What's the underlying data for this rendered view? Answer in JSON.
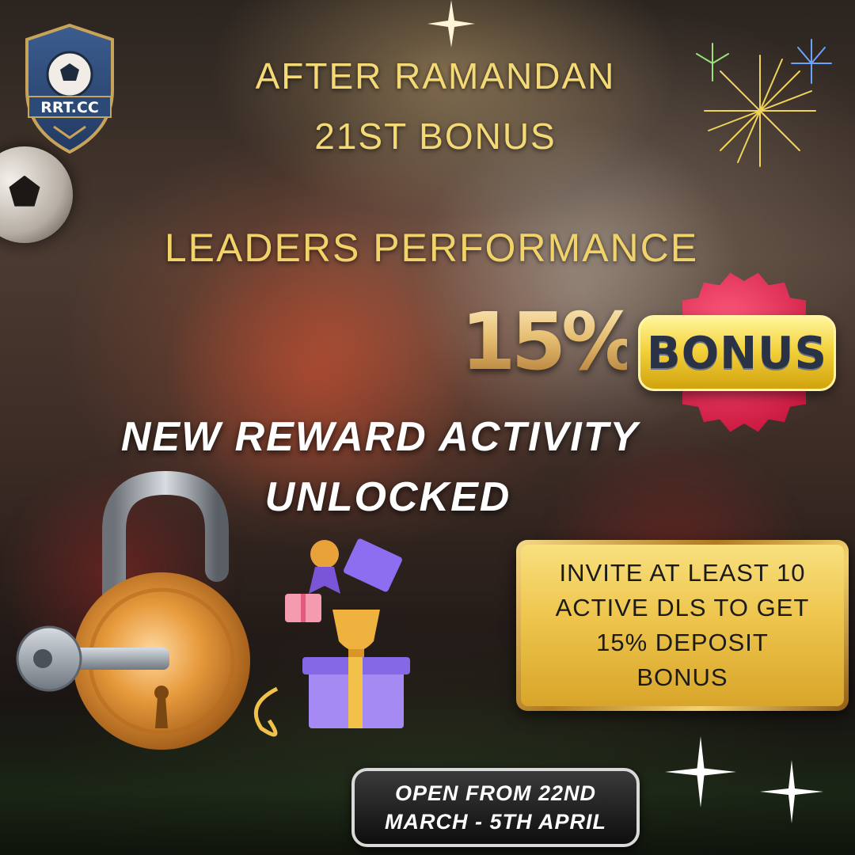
{
  "logo": {
    "text": "RRT.CC",
    "icon": "soccer-shield-logo"
  },
  "headline": {
    "line1": "AFTER RAMANDAN",
    "line2": "21ST BONUS",
    "subtitle": "LEADERS PERFORMANCE"
  },
  "offer": {
    "percent": "15%",
    "badge": "BONUS"
  },
  "activity": {
    "line1": "NEW REWARD ACTIVITY",
    "line2": "UNLOCKED"
  },
  "invite": {
    "line1": "INVITE AT LEAST 10",
    "line2": "ACTIVE DLS TO GET",
    "line3": "15% DEPOSIT",
    "line4": "BONUS"
  },
  "schedule": {
    "line1": "OPEN FROM 22ND",
    "line2": "MARCH - 5TH APRIL"
  },
  "icons": [
    "soccer-ball-icon",
    "padlock-icon",
    "key-icon",
    "gift-box-icon",
    "trophy-icon",
    "medal-icon",
    "firework-icon",
    "sparkle-icon"
  ],
  "colors": {
    "headline_gold": "#f3da76",
    "badge_yellow": "#f4d23c",
    "seal_pink": "#e8325a",
    "badge_text": "#2a3346",
    "box_gold": "#eec54d",
    "pill_dark": "#0e0e0e"
  }
}
